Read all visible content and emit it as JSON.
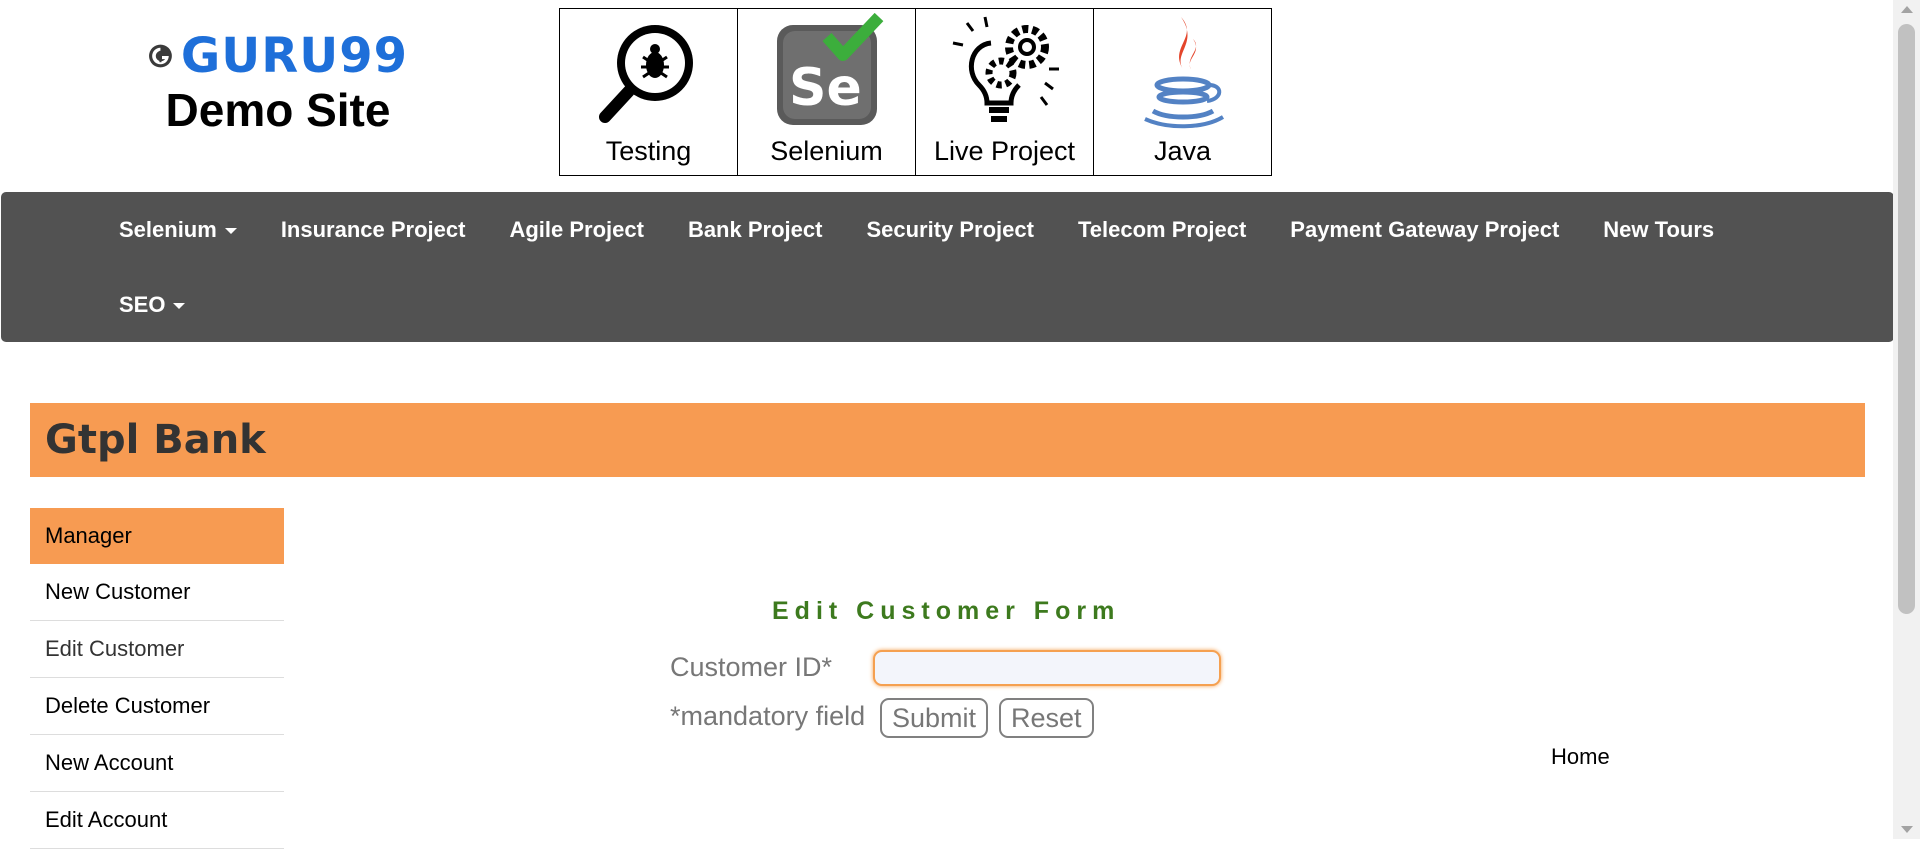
{
  "header": {
    "logo": {
      "brand": "GURU99",
      "subtitle": "Demo Site"
    },
    "tiles": [
      {
        "label": "Testing",
        "icon": "magnifier-bug-icon"
      },
      {
        "label": "Selenium",
        "icon": "selenium-logo-icon"
      },
      {
        "label": "Live Project",
        "icon": "lightbulb-gears-icon"
      },
      {
        "label": "Java",
        "icon": "java-cup-icon"
      }
    ]
  },
  "nav": {
    "row1": [
      "Selenium",
      "Insurance Project",
      "Agile Project",
      "Bank Project",
      "Security Project",
      "Telecom Project",
      "Payment Gateway Project",
      "New Tours"
    ],
    "row2": [
      "SEO"
    ]
  },
  "bank": {
    "title": "Gtpl Bank"
  },
  "sidebar": {
    "items": [
      "Manager",
      "New Customer",
      "Edit Customer",
      "Delete Customer",
      "New Account",
      "Edit Account"
    ]
  },
  "form": {
    "title": "Edit Customer Form",
    "customer_id_label": "Customer ID*",
    "customer_id_value": "",
    "mandatory_note": "*mandatory field",
    "submit_label": "Submit",
    "reset_label": "Reset"
  },
  "footer": {
    "home_link": "Home"
  },
  "colors": {
    "accent_orange": "#f79b52",
    "nav_bg": "#525252",
    "form_title_green": "#3d7a1e",
    "brand_blue": "#1e6fd9"
  }
}
